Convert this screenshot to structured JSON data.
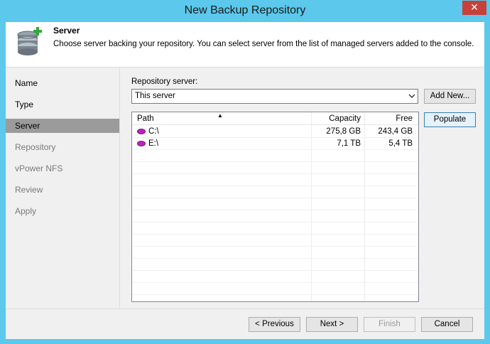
{
  "window": {
    "title": "New Backup Repository",
    "close_glyph": "✕"
  },
  "header": {
    "title": "Server",
    "description": "Choose server backing your repository. You can select server from the list of managed servers added to the console.",
    "icon": "database-add-icon"
  },
  "nav": {
    "items": [
      {
        "label": "Name",
        "state": "normal"
      },
      {
        "label": "Type",
        "state": "normal"
      },
      {
        "label": "Server",
        "state": "active"
      },
      {
        "label": "Repository",
        "state": "disabled"
      },
      {
        "label": "vPower NFS",
        "state": "disabled"
      },
      {
        "label": "Review",
        "state": "disabled"
      },
      {
        "label": "Apply",
        "state": "disabled"
      }
    ]
  },
  "server": {
    "label": "Repository server:",
    "selected": "This server",
    "add_new_label": "Add New...",
    "populate_label": "Populate"
  },
  "table": {
    "columns": [
      "Path",
      "Capacity",
      "Free"
    ],
    "sort_glyph": "▲",
    "rows": [
      {
        "path": "C:\\",
        "capacity": "275,8 GB",
        "free": "243,4 GB"
      },
      {
        "path": "E:\\",
        "capacity": "7,1 TB",
        "free": "5,4 TB"
      }
    ]
  },
  "footer": {
    "previous_label": "< Previous",
    "next_label": "Next >",
    "finish_label": "Finish",
    "cancel_label": "Cancel"
  },
  "colors": {
    "title_bar": "#5bc8ec",
    "close_button": "#c7403a",
    "nav_active": "#9b9b9b",
    "disk_icon": "#c020c0"
  }
}
